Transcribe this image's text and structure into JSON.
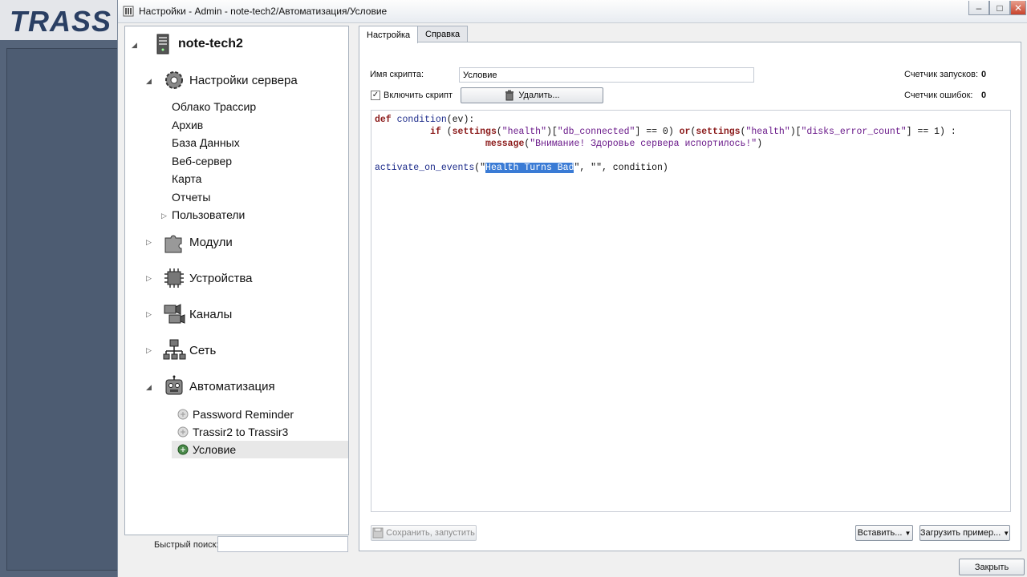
{
  "background": {
    "logo_text": "TRASS"
  },
  "window": {
    "title": "Настройки - Admin - note-tech2/Автоматизация/Условие",
    "minimize_label": "–",
    "maximize_label": "□",
    "close_label": "✕"
  },
  "tree": {
    "root": "note-tech2",
    "server_settings": "Настройки сервера",
    "server_items": [
      "Облако Трассир",
      "Архив",
      "База Данных",
      "Веб-сервер",
      "Карта",
      "Отчеты",
      "Пользователи"
    ],
    "modules": "Модули",
    "devices": "Устройства",
    "channels": "Каналы",
    "network": "Сеть",
    "automation": "Автоматизация",
    "scripts": [
      "Password Reminder",
      "Trassir2 to Trassir3",
      "Условие"
    ]
  },
  "quick_search": {
    "label": "Быстрый поиск:",
    "value": ""
  },
  "tabs": [
    "Настройка",
    "Справка"
  ],
  "form": {
    "script_name_label": "Имя скрипта:",
    "script_name_value": "Условие",
    "enable_label": "Включить скрипт",
    "enable_checked": true,
    "delete_button": "Удалить...",
    "runs_label": "Счетчик запусков:",
    "runs_value": "0",
    "errors_label": "Счетчик ошибок:",
    "errors_value": "0"
  },
  "code": {
    "l1_kw": "def",
    "l1_fn": "condition",
    "l1_rest": "(ev):",
    "l2_indent": "          ",
    "l2_if": "if",
    "l2_a": " (",
    "l2_settings1": "settings",
    "l2_b": "(",
    "l2_health1": "\"health\"",
    "l2_c": ")[",
    "l2_db": "\"db_connected\"",
    "l2_d": "] == 0) ",
    "l2_or": "or",
    "l2_e": "(",
    "l2_settings2": "settings",
    "l2_f": "(",
    "l2_health2": "\"health\"",
    "l2_g": ")[",
    "l2_disks": "\"disks_error_count\"",
    "l2_h": "] == 1) :",
    "l3_indent": "                    ",
    "l3_msg": "message",
    "l3_a": "(",
    "l3_str": "\"Внимание! Здоровье сервера испортилось!\"",
    "l3_b": ")",
    "l5_fn": "activate_on_events",
    "l5_a": "(\"",
    "l5_sel": "Health Turns Bad",
    "l5_b": "\", \"\", condition)"
  },
  "bottom": {
    "save_run": "Сохранить, запустить",
    "insert": "Вставить...",
    "load_example": "Загрузить пример...",
    "close": "Закрыть"
  }
}
